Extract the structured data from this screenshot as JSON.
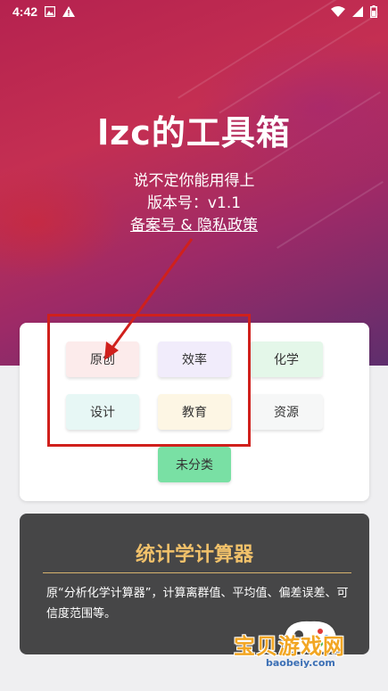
{
  "status_bar": {
    "time": "4:42"
  },
  "header": {
    "title": "lzc的工具箱",
    "subtitle": "说不定你能用得上",
    "version": "版本号：v1.1",
    "policy_link": "备案号 & 隐私政策"
  },
  "categories": [
    {
      "label": "原创",
      "color": "#fcebeb"
    },
    {
      "label": "效率",
      "color": "#f1ecfb"
    },
    {
      "label": "化学",
      "color": "#e4f7e9"
    },
    {
      "label": "设计",
      "color": "#e7f7f5"
    },
    {
      "label": "教育",
      "color": "#fdf6e4"
    },
    {
      "label": "资源",
      "color": "#f6f7f7"
    },
    {
      "label": "未分类",
      "color": "#79e0a4"
    }
  ],
  "tool_card": {
    "title": "统计学计算器",
    "description": "原“分析化学计算器”，计算离群值、平均值、偏差误差、可信度范围等。"
  },
  "watermark": {
    "text": "宝贝游戏网",
    "url": "baobeiy.com"
  },
  "colors": {
    "annotation_red": "#d0201c",
    "accent_gold": "#f1c16a"
  }
}
